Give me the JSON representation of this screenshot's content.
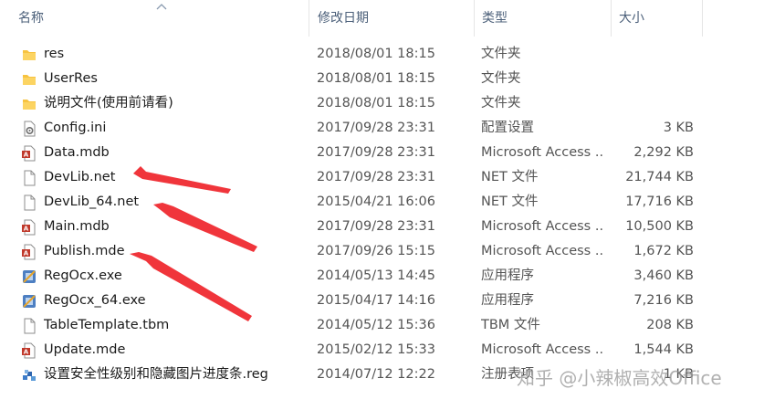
{
  "columns": {
    "name": "名称",
    "date": "修改日期",
    "type": "类型",
    "size": "大小"
  },
  "files": [
    {
      "icon": "folder-icon",
      "name": "res",
      "date": "2018/08/01 18:15",
      "type": "文件夹",
      "size": ""
    },
    {
      "icon": "folder-icon",
      "name": "UserRes",
      "date": "2018/08/01 18:15",
      "type": "文件夹",
      "size": ""
    },
    {
      "icon": "folder-icon",
      "name": "说明文件(使用前请看)",
      "date": "2018/08/01 18:15",
      "type": "文件夹",
      "size": ""
    },
    {
      "icon": "config-file-icon",
      "name": "Config.ini",
      "date": "2017/09/28 23:31",
      "type": "配置设置",
      "size": "3 KB"
    },
    {
      "icon": "access-db-icon",
      "name": "Data.mdb",
      "date": "2017/09/28 23:31",
      "type": "Microsoft Access ...",
      "size": "2,292 KB"
    },
    {
      "icon": "blank-file-icon",
      "name": "DevLib.net",
      "date": "2017/09/28 23:31",
      "type": "NET 文件",
      "size": "21,744 KB"
    },
    {
      "icon": "blank-file-icon",
      "name": "DevLib_64.net",
      "date": "2015/04/21 16:06",
      "type": "NET 文件",
      "size": "17,716 KB"
    },
    {
      "icon": "access-db-icon",
      "name": "Main.mdb",
      "date": "2017/09/28 23:31",
      "type": "Microsoft Access ...",
      "size": "10,500 KB"
    },
    {
      "icon": "access-db-icon",
      "name": "Publish.mde",
      "date": "2017/09/26 15:15",
      "type": "Microsoft Access ...",
      "size": "1,672 KB"
    },
    {
      "icon": "installer-icon",
      "name": "RegOcx.exe",
      "date": "2014/05/13 14:45",
      "type": "应用程序",
      "size": "3,460 KB"
    },
    {
      "icon": "installer-icon",
      "name": "RegOcx_64.exe",
      "date": "2015/04/17 14:16",
      "type": "应用程序",
      "size": "7,216 KB"
    },
    {
      "icon": "blank-file-icon",
      "name": "TableTemplate.tbm",
      "date": "2014/05/12 15:36",
      "type": "TBM 文件",
      "size": "208 KB"
    },
    {
      "icon": "access-db-icon",
      "name": "Update.mde",
      "date": "2015/02/12 15:33",
      "type": "Microsoft Access ...",
      "size": "1,544 KB"
    },
    {
      "icon": "registry-file-icon",
      "name": "设置安全性级别和隐藏图片进度条.reg",
      "date": "2014/07/12 12:22",
      "type": "注册表项",
      "size": "1 KB"
    }
  ],
  "watermark": "知乎 @小辣椒高效Office",
  "colors": {
    "folder": "#f7c340",
    "access": "#c0392b",
    "arrow": "#f0353b",
    "header_text": "#4c607a"
  }
}
